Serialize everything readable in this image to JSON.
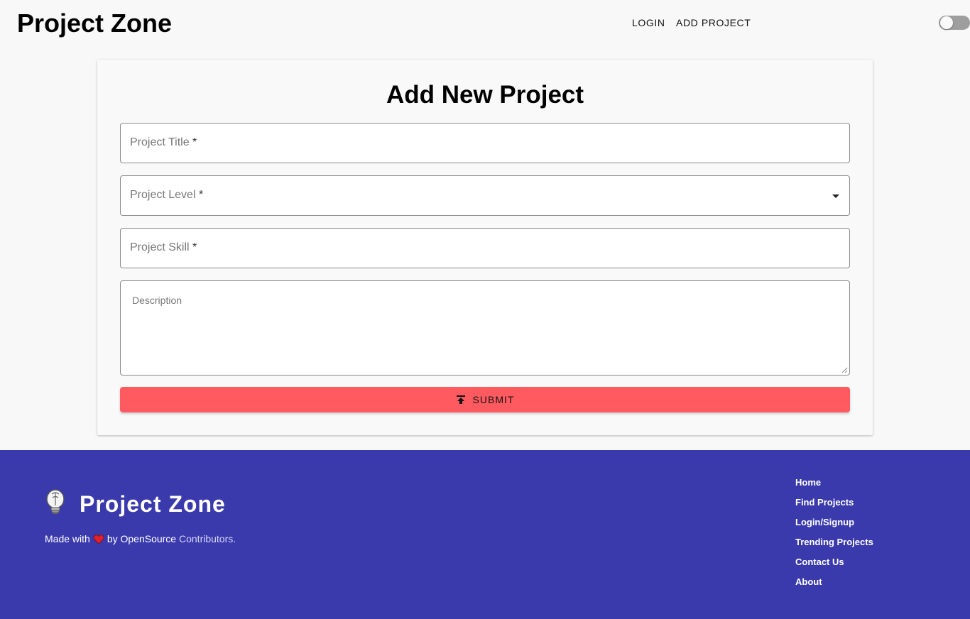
{
  "header": {
    "brand": "Project Zone",
    "nav": {
      "login": "LOGIN",
      "add_project": "ADD PROJECT"
    },
    "theme_toggle": {
      "state": "off"
    }
  },
  "form": {
    "title": "Add New Project",
    "fields": {
      "project_title": {
        "label": "Project Title",
        "required_mark": "*",
        "value": ""
      },
      "project_level": {
        "label": "Project Level",
        "required_mark": "*",
        "value": ""
      },
      "project_skill": {
        "label": "Project Skill",
        "required_mark": "*",
        "value": ""
      },
      "description": {
        "placeholder": "Description",
        "value": ""
      }
    },
    "submit_label": "SUBMIT"
  },
  "footer": {
    "brand": "Project Zone",
    "made_with": "Made with",
    "by": "by OpenSource",
    "contributors": "Contributors.",
    "links": [
      "Home",
      "Find Projects",
      "Login/Signup",
      "Trending Projects",
      "Contact Us",
      "About"
    ]
  },
  "icons": {
    "logo": "lightbulb-icon",
    "heart": "heart-icon",
    "submit": "upload-icon",
    "select": "arrow-drop-down-icon"
  },
  "colors": {
    "accent": "#ff5a5f",
    "footer_bg": "#3a3aad",
    "heart": "#e0202a"
  }
}
